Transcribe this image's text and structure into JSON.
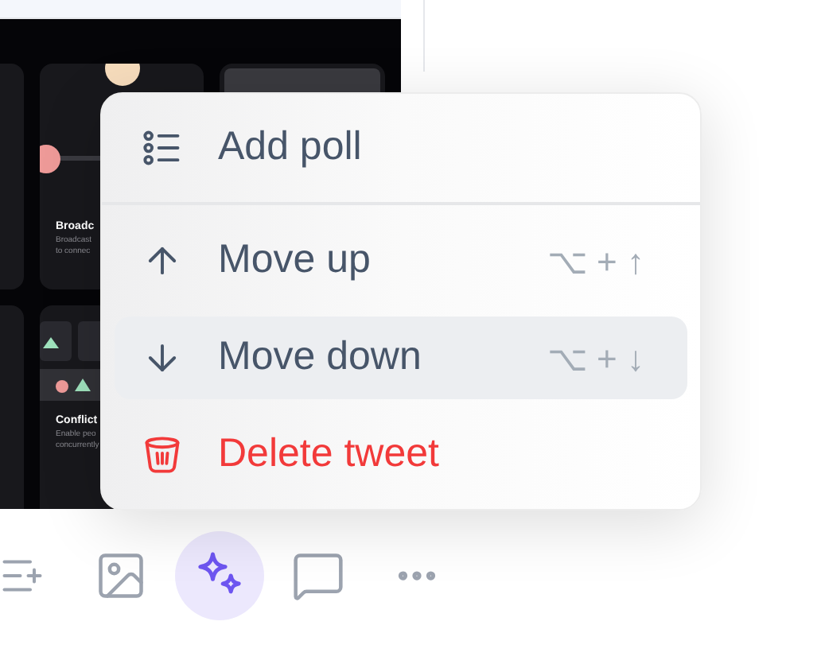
{
  "preview": {
    "cards": [
      {
        "title": "Broadc",
        "description": [
          "Broadcast",
          "to connec"
        ],
        "kind": "broadcast"
      },
      {
        "title": "Conflict",
        "description": [
          "Enable peo",
          "concurrently"
        ],
        "kind": "conflict"
      }
    ]
  },
  "menu": {
    "items": [
      {
        "kind": "poll",
        "label": "Add poll",
        "selected": false
      },
      {
        "kind": "up",
        "label": "Move up",
        "shortcut": "⌥ + ↑",
        "selected": false
      },
      {
        "kind": "down",
        "label": "Move down",
        "shortcut": "⌥ + ↓",
        "selected": true
      },
      {
        "kind": "delete",
        "label": "Delete tweet",
        "selected": false
      }
    ]
  },
  "toolbar": [
    {
      "kind": "list-plus",
      "selected": false
    },
    {
      "kind": "image",
      "selected": false
    },
    {
      "kind": "sparkles",
      "selected": true
    },
    {
      "kind": "comment",
      "selected": false
    },
    {
      "kind": "more",
      "selected": false
    }
  ]
}
